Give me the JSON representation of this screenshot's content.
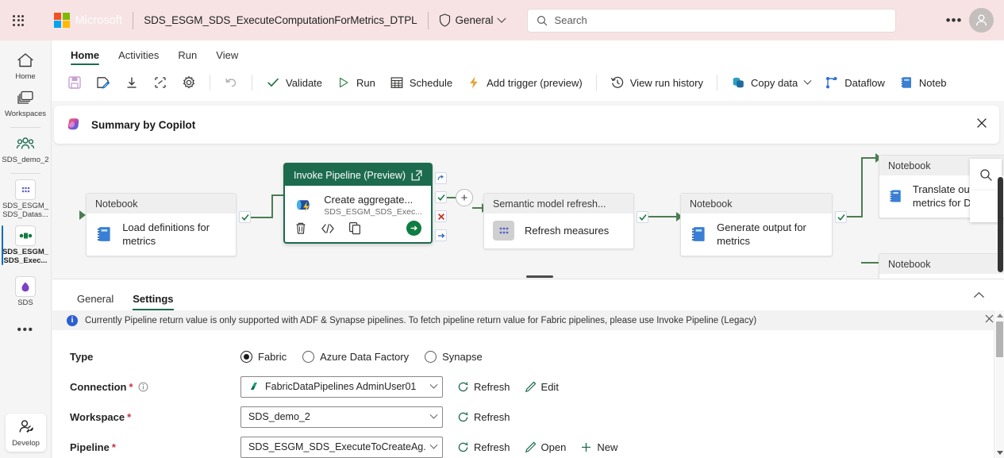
{
  "topbar": {
    "brand": "Microsoft",
    "doc_title": "SDS_ESGM_SDS_ExecuteComputationForMetrics_DTPL",
    "workspace_chip": "General",
    "search_placeholder": "Search",
    "more_label": "•••"
  },
  "rail": {
    "items": [
      {
        "label": "Home",
        "icon": "home-icon"
      },
      {
        "label": "Workspaces",
        "icon": "workspaces-icon"
      },
      {
        "label": "SDS_demo_2",
        "icon": "people-icon"
      },
      {
        "label": "SDS_ESGM_SDS_Datas...",
        "icon": "dataset-icon"
      },
      {
        "label": "SDS_ESGM_SDS_Exec...",
        "icon": "pipeline-icon"
      },
      {
        "label": "SDS",
        "icon": "semantic-model-icon"
      }
    ],
    "more": "•••",
    "develop": "Develop"
  },
  "ribbon": {
    "tabs": [
      {
        "label": "Home",
        "active": true
      },
      {
        "label": "Activities",
        "active": false
      },
      {
        "label": "Run",
        "active": false
      },
      {
        "label": "View",
        "active": false
      }
    ],
    "commands": [
      {
        "label": "",
        "icon": "save-icon"
      },
      {
        "label": "",
        "icon": "save-as-icon"
      },
      {
        "label": "",
        "icon": "import-icon"
      },
      {
        "label": "",
        "icon": "share-icon"
      },
      {
        "label": "",
        "icon": "settings-gear-icon"
      },
      {
        "label": "",
        "icon": "undo-icon"
      },
      {
        "label": "Validate",
        "icon": "checkmark-icon"
      },
      {
        "label": "Run",
        "icon": "play-icon"
      },
      {
        "label": "Schedule",
        "icon": "calendar-icon"
      },
      {
        "label": "Add trigger (preview)",
        "icon": "lightning-icon"
      },
      {
        "label": "View run history",
        "icon": "history-icon"
      },
      {
        "label": "Copy data",
        "icon": "copy-data-icon"
      },
      {
        "label": "Dataflow",
        "icon": "dataflow-icon"
      },
      {
        "label": "Noteb",
        "icon": "notebook-icon"
      }
    ]
  },
  "copilot": {
    "title": "Summary by Copilot",
    "close": "close-icon"
  },
  "canvas": {
    "nodes": [
      {
        "type": "Notebook",
        "name": "Load definitions for metrics"
      },
      {
        "type": "Invoke Pipeline (Preview)",
        "name": "Create aggregate...",
        "subtitle": "SDS_ESGM_SDS_Exec...",
        "selected": true
      },
      {
        "type": "Semantic model refresh...",
        "name": "Refresh measures"
      },
      {
        "type": "Notebook",
        "name": "Generate output for metrics"
      },
      {
        "type": "Notebook",
        "name": "Translate output metrics for DM"
      },
      {
        "type": "Notebook",
        "name": ""
      }
    ]
  },
  "panel": {
    "tabs": [
      {
        "label": "General",
        "active": false
      },
      {
        "label": "Settings",
        "active": true
      }
    ],
    "info_message": "Currently Pipeline return value is only supported with ADF & Synapse pipelines. To fetch pipeline return value for Fabric pipelines, please use Invoke Pipeline (Legacy)",
    "fields": {
      "type": {
        "label": "Type",
        "options": [
          {
            "label": "Fabric",
            "selected": true
          },
          {
            "label": "Azure Data Factory",
            "selected": false
          },
          {
            "label": "Synapse",
            "selected": false
          }
        ]
      },
      "connection": {
        "label": "Connection",
        "required": "*",
        "value": "FabricDataPipelines AdminUser01",
        "actions": [
          "Refresh",
          "Edit"
        ]
      },
      "workspace": {
        "label": "Workspace",
        "required": "*",
        "value": "SDS_demo_2",
        "actions": [
          "Refresh"
        ]
      },
      "pipeline": {
        "label": "Pipeline",
        "required": "*",
        "value": "SDS_ESGM_SDS_ExecuteToCreateAg...",
        "actions": [
          "Refresh",
          "Open",
          "New"
        ]
      }
    }
  },
  "colors": {
    "topbar_bg": "#f7e3e3",
    "accent_green": "#1d6b4f",
    "selected_node_border": "#1d6b4f",
    "required_red": "#c4314b",
    "info_blue": "#2c5fd0"
  }
}
